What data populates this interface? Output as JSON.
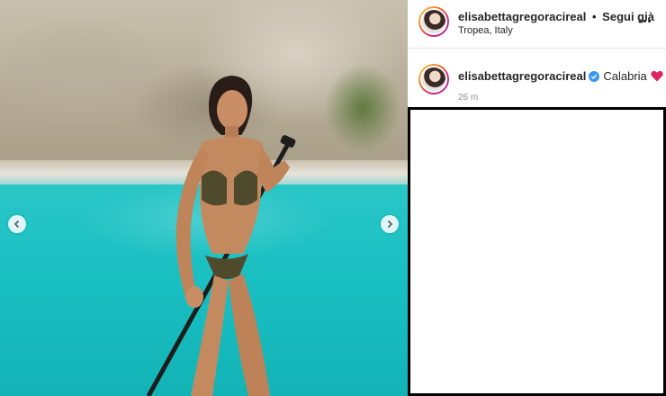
{
  "post": {
    "username": "elisabettagregoracireal",
    "separator": "•",
    "follow_label": "Segui già",
    "location": "Tropea, Italy",
    "more_icon": "more-horizontal-icon"
  },
  "caption": {
    "username": "elisabettagregoracireal",
    "verified_icon": "verified-badge-icon",
    "text": "Calabria",
    "emoji_icon": "red-heart-icon",
    "time": "26 m"
  },
  "carousel": {
    "prev_icon": "chevron-left-icon",
    "next_icon": "chevron-right-icon"
  },
  "colors": {
    "verified": "#3897f0",
    "heart": "#e0245e",
    "water": "#1cc3c4"
  }
}
